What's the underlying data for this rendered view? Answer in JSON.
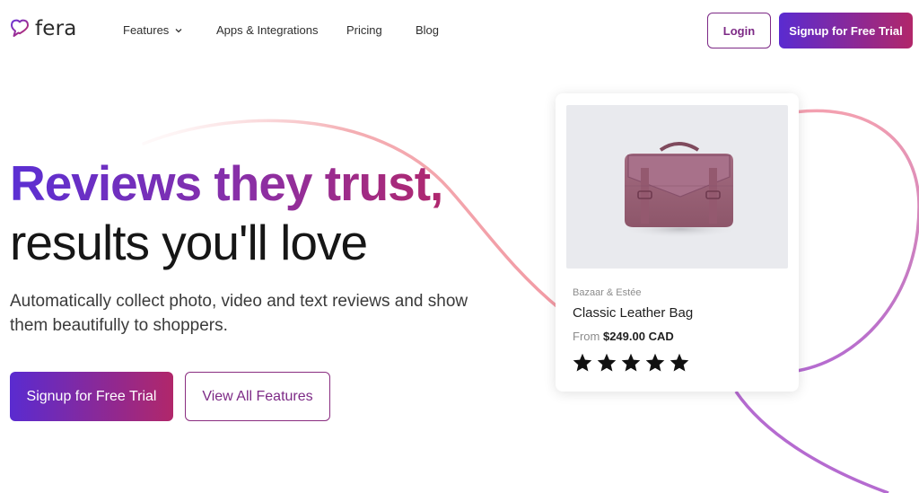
{
  "brand": {
    "name": "fera",
    "logo_icon": "heart-speech-bubble-icon",
    "accent": "#7d2a86"
  },
  "nav": {
    "items": [
      {
        "label": "Features",
        "has_dropdown": true
      },
      {
        "label": "Apps & Integrations"
      },
      {
        "label": "Pricing"
      },
      {
        "label": "Blog"
      }
    ],
    "login_label": "Login",
    "signup_label": "Signup for Free Trial"
  },
  "hero": {
    "title_line1": "Reviews they trust,",
    "title_line2": "results you'll love",
    "subtitle": "Automatically collect photo, video and text reviews and show them beautifully to shoppers.",
    "primary_cta": "Signup for Free Trial",
    "secondary_cta": "View All Features"
  },
  "product_card": {
    "brand": "Bazaar & Estée",
    "name": "Classic Leather Bag",
    "price_prefix": "From",
    "price": "$249.00 CAD",
    "rating": 5,
    "rating_max": 5,
    "star_icon": "star-icon"
  },
  "colors": {
    "gradient_start": "#5a2bd0",
    "gradient_end": "#b1276a",
    "arc_pink": "#f3a7ad",
    "arc_purple": "#b66bd0"
  }
}
